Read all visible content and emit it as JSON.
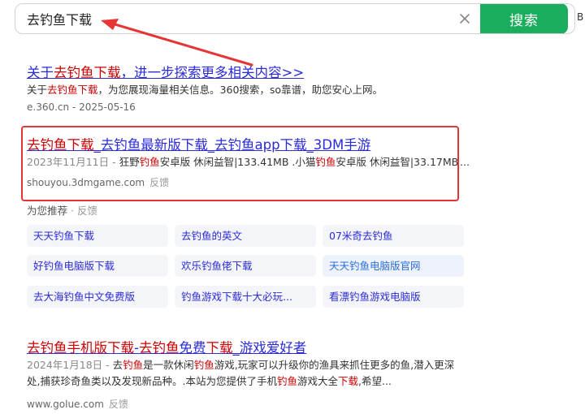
{
  "search": {
    "query": "去钓鱼下载",
    "button_label": "搜索",
    "side_text": "B"
  },
  "results": [
    {
      "title_parts": [
        {
          "t": "关于",
          "hl": false
        },
        {
          "t": "去钓鱼下载",
          "hl": true
        },
        {
          "t": "，进一步探索更多相关内容>>",
          "hl": false
        }
      ],
      "desc_parts": [
        {
          "t": "关于",
          "hl": false
        },
        {
          "t": "去钓鱼下载",
          "hl": true
        },
        {
          "t": "，为您展现海量相关信息。360搜索，so靠谱，助您安心上网。",
          "hl": false
        }
      ],
      "url": "e.360.cn - 2025-05-16"
    },
    {
      "title_parts": [
        {
          "t": "去钓鱼下载",
          "hl": true
        },
        {
          "t": "_去钓鱼最新版下载_去钓鱼app下载_3DM手游",
          "hl": false
        }
      ],
      "date": "2023年11月11日 - ",
      "desc_parts": [
        {
          "t": "狂野",
          "hl": false
        },
        {
          "t": "钓鱼",
          "hl": true
        },
        {
          "t": "安卓版 休闲益智|133.41MB .小猫",
          "hl": false
        },
        {
          "t": "钓鱼",
          "hl": true
        },
        {
          "t": "安卓版 休闲益智|33.17MB",
          "hl": false
        }
      ],
      "more": "...",
      "url": "shouyou.3dmgame.com",
      "feedback": "反馈"
    },
    {
      "title_parts": [
        {
          "t": "去钓鱼手机版下载",
          "hl": true
        },
        {
          "t": "-",
          "hl": false
        },
        {
          "t": "去钓鱼",
          "hl": true
        },
        {
          "t": "免费",
          "hl": false
        },
        {
          "t": "下载",
          "hl": true
        },
        {
          "t": "_游戏爱好者",
          "hl": false
        }
      ],
      "date": "2024年1月18日 - ",
      "desc_parts": [
        {
          "t": "去",
          "hl": false
        },
        {
          "t": "钓鱼",
          "hl": true
        },
        {
          "t": "是一款休闲",
          "hl": false
        },
        {
          "t": "钓鱼",
          "hl": true
        },
        {
          "t": "游戏,玩家可以升级你的渔具来抓住更多的鱼,潜入更深",
          "hl": false
        }
      ],
      "desc_line2_parts": [
        {
          "t": "处,捕获珍奇鱼类以及发现新品种。.本站为您提供了手机",
          "hl": false
        },
        {
          "t": "钓鱼",
          "hl": true
        },
        {
          "t": "游戏大全",
          "hl": false
        },
        {
          "t": "下载",
          "hl": true
        },
        {
          "t": ",希望...",
          "hl": false
        }
      ],
      "url": "www.golue.com",
      "feedback": "反馈"
    }
  ],
  "recommend": {
    "heading": "为您推荐",
    "sep": " · ",
    "feedback": "反馈",
    "chips": [
      "天天钓鱼下载",
      "去钓鱼的英文",
      "07米奇去钓鱼",
      "好钓鱼电脑版下载",
      "欢乐钓鱼佬下载",
      "天天钓鱼电脑版官网",
      "去大海钓鱼中文免费版",
      "钓鱼游戏下载十大必玩...",
      "看漂钓鱼游戏电脑版"
    ]
  },
  "colors": {
    "accent": "#1aad5d",
    "link": "#2b2bd8",
    "highlight": "#cc0000",
    "annotation": "#e53535"
  }
}
